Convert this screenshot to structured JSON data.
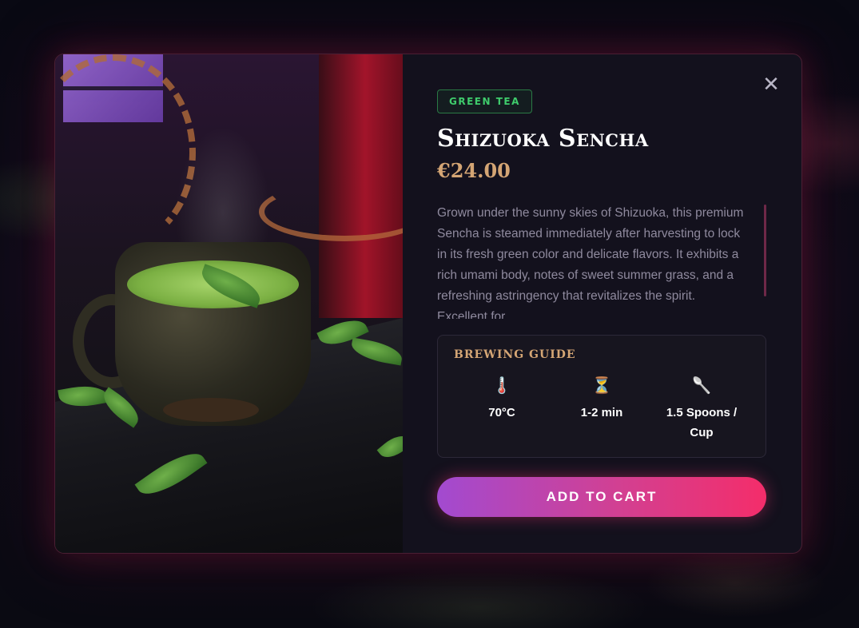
{
  "product": {
    "category_tag": "GREEN TEA",
    "name": "Shizuoka Sencha",
    "price": "€24.00",
    "description": "Grown under the sunny skies of Shizuoka, this premium Sencha is steamed immediately after harvesting to lock in its fresh green color and delicate flavors. It exhibits a rich umami body, notes of sweet summer grass, and a refreshing astringency that revitalizes the spirit. Excellent for"
  },
  "brewing_guide": {
    "title": "BREWING GUIDE",
    "items": [
      {
        "icon": "thermometer-icon",
        "glyph": "🌡️",
        "value": "70°C"
      },
      {
        "icon": "hourglass-icon",
        "glyph": "⏳",
        "value": "1-2 min"
      },
      {
        "icon": "spoon-icon",
        "glyph": "🥄",
        "value": "1.5 Spoons / Cup"
      }
    ]
  },
  "actions": {
    "add_to_cart_label": "ADD TO CART",
    "close_glyph": "✕"
  },
  "colors": {
    "accent_gradient_start": "#a24ad0",
    "accent_gradient_end": "#f42d6a",
    "price": "#d4a574",
    "tag_green": "#3fcc6c"
  }
}
